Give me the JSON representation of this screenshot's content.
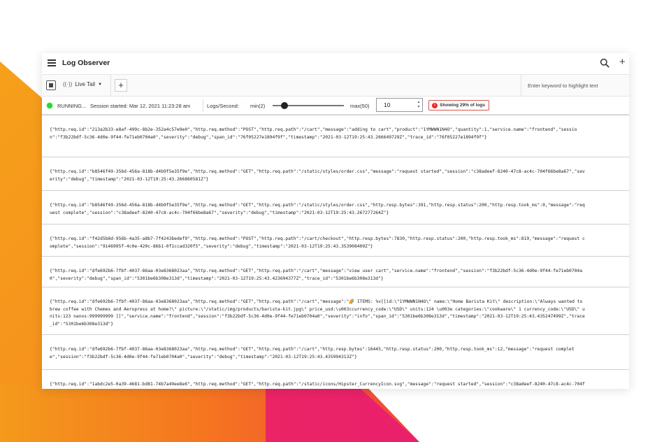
{
  "app": {
    "title": "Log Observer"
  },
  "icons": {
    "menu": "hamburger-menu-icon",
    "search": "search-icon",
    "add": "plus-icon",
    "stop": "stop-icon",
    "live": "broadcast-icon",
    "warning": "warning-icon"
  },
  "toolbar": {
    "live_tail_label": "Live Tail",
    "add_tab_label": "+",
    "highlight_placeholder": "Enter keyword to highlight text"
  },
  "status": {
    "state": "RUNNING...",
    "session": "Session started: Mar 12, 2021 11:23:28 am",
    "logs_per_second_label": "Logs/Second:",
    "min_label": "min(2)",
    "max_label": "max(50)",
    "rate_value": "10",
    "slider_value": 10,
    "slider_min": 2,
    "slider_max": 50,
    "showing": "Showing 29% of logs",
    "colors": {
      "running": "#2fd13c",
      "warning": "#e22222"
    }
  },
  "logs": [
    {
      "lines": [
        "{\"http.req.id\":\"213a2b33-e8af-499c-8b2e-352a4c57e9e0\",\"http.req.method\":\"POST\",\"http.req.path\":\"/cart\",\"message\":\"adding to cart\",\"product\":\"1YMWWN1N4O\",\"quantity\":1,\"service.name\":\"frontend\",\"sessio",
        "n\":\"f3b22bdf-5c36-4d0e-9f44-fe71eb0704a0\",\"severity\":\"debug\",\"span_id\":\"76f05227e1894f9f\",\"timestamp\":\"2021-03-12T19:25:43.266649729Z\",\"trace_id\":\"76f05227e1894f9f\"}"
      ]
    },
    {
      "lines": [
        "{\"http.req.id\":\"b8546f49-356d-456a-818b-d4b9f5e35f9e\",\"http.req.method\":\"GET\",\"http.req.path\":\"/static/styles/order.css\",\"message\":\"request started\",\"session\":\"c38adeef-8240-47c8-ac4c-704f66be8a67\",\"sev",
        "erity\":\"debug\",\"timestamp\":\"2021-03-12T19:25:43.266860581Z\"}"
      ]
    },
    {
      "lines": [
        "{\"http.req.id\":\"b8546f49-356d-456a-818b-d4b9f5e35f9e\",\"http.req.method\":\"GET\",\"http.req.path\":\"/static/styles/order.css\",\"http.resp.bytes\":391,\"http.resp.status\":200,\"http.resp.took_ms\":0,\"message\":\"req",
        "uest complete\",\"session\":\"c38adeef-8240-47c8-ac4c-704f66be8a67\",\"severity\":\"debug\",\"timestamp\":\"2021-03-12T19:25:43.267277264Z\"}"
      ]
    },
    {
      "lines": [
        "{\"http.req.id\":\"f42d5b8d-956b-4a35-a8b7-7f4243bedef9\",\"http.req.method\":\"POST\",\"http.req.path\":\"/cart/checkout\",\"http.resp.bytes\":7830,\"http.resp.status\":200,\"http.resp.took_ms\":819,\"message\":\"request c",
        "omplete\",\"session\":\"9146995f-4c0e-420c-86b1-0f1ccad320f5\",\"severity\":\"debug\",\"timestamp\":\"2021-03-12T19:25:43.353908409Z\"}"
      ]
    },
    {
      "lines": [
        "{\"http.req.id\":\"dfe692b6-7fbf-4037-86aa-03e8368023aa\",\"http.req.method\":\"GET\",\"http.req.path\":\"/cart\",\"message\":\"view user cart\",\"service.name\":\"frontend\",\"session\":\"f3b22bdf-5c36-4d0e-9f44-fe71eb0704a",
        "0\",\"severity\":\"debug\",\"span_id\":\"5301be6b308e313d\",\"timestamp\":\"2021-03-12T19:25:43.423694377Z\",\"trace_id\":\"5301be6b308e313d\"}"
      ]
    },
    {
      "lines": [
        "{\"http.req.id\":\"dfe692b6-7fbf-4037-86aa-03e8368023aa\",\"http.req.method\":\"GET\",\"http.req.path\":\"/cart\",\"message\":\"🌈 ITEMS: %v[[id:\\\"1YMWWN1N4O\\\" name:\\\"Home Barista Kit\\\" description:\\\"Always wanted to",
        "brew coffee with Chemex and Aeropress at home?\\\" picture:\\\"/static/img/products/barista-kit.jpg\\\" price_usd:\\u003ccurrency_code:\\\"USD\\\" units:124 \\u003e categories:\\\"cookware\\\" 1 currency_code:\\\"USD\\\" u",
        "nits:123 nanos:999999999 ]]\",\"service.name\":\"frontend\",\"session\":\"f3b22bdf-5c36-4d0e-9f44-fe71eb0704a0\",\"severity\":\"info\",\"span_id\":\"5301be6b308e313d\",\"timestamp\":\"2021-03-12T19:25:43.435247499Z\",\"trace",
        "_id\":\"5301be6b308e313d\"}"
      ]
    },
    {
      "lines": [
        "{\"http.req.id\":\"dfe692b6-7fbf-4037-86aa-03e8368023aa\",\"http.req.method\":\"GET\",\"http.req.path\":\"/cart\",\"http.resp.bytes\":16445,\"http.resp.status\":200,\"http.resp.took_ms\":12,\"message\":\"request complet",
        "e\",\"session\":\"f3b22bdf-5c36-4d0e-9f44-fe71eb0704a0\",\"severity\":\"debug\",\"timestamp\":\"2021-03-12T19:25:43.435994313Z\"}"
      ]
    },
    {
      "lines": [
        "{\"http.req.id\":\"1abdc2e5-0a39-4681-bd81-74b7a49ee8e6\",\"http.req.method\":\"GET\",\"http.req.path\":\"/static/icons/Hipster_CurrencyIcon.svg\",\"message\":\"request started\",\"session\":\"c38adeef-8240-47c8-ac4c-704f"
      ]
    }
  ]
}
